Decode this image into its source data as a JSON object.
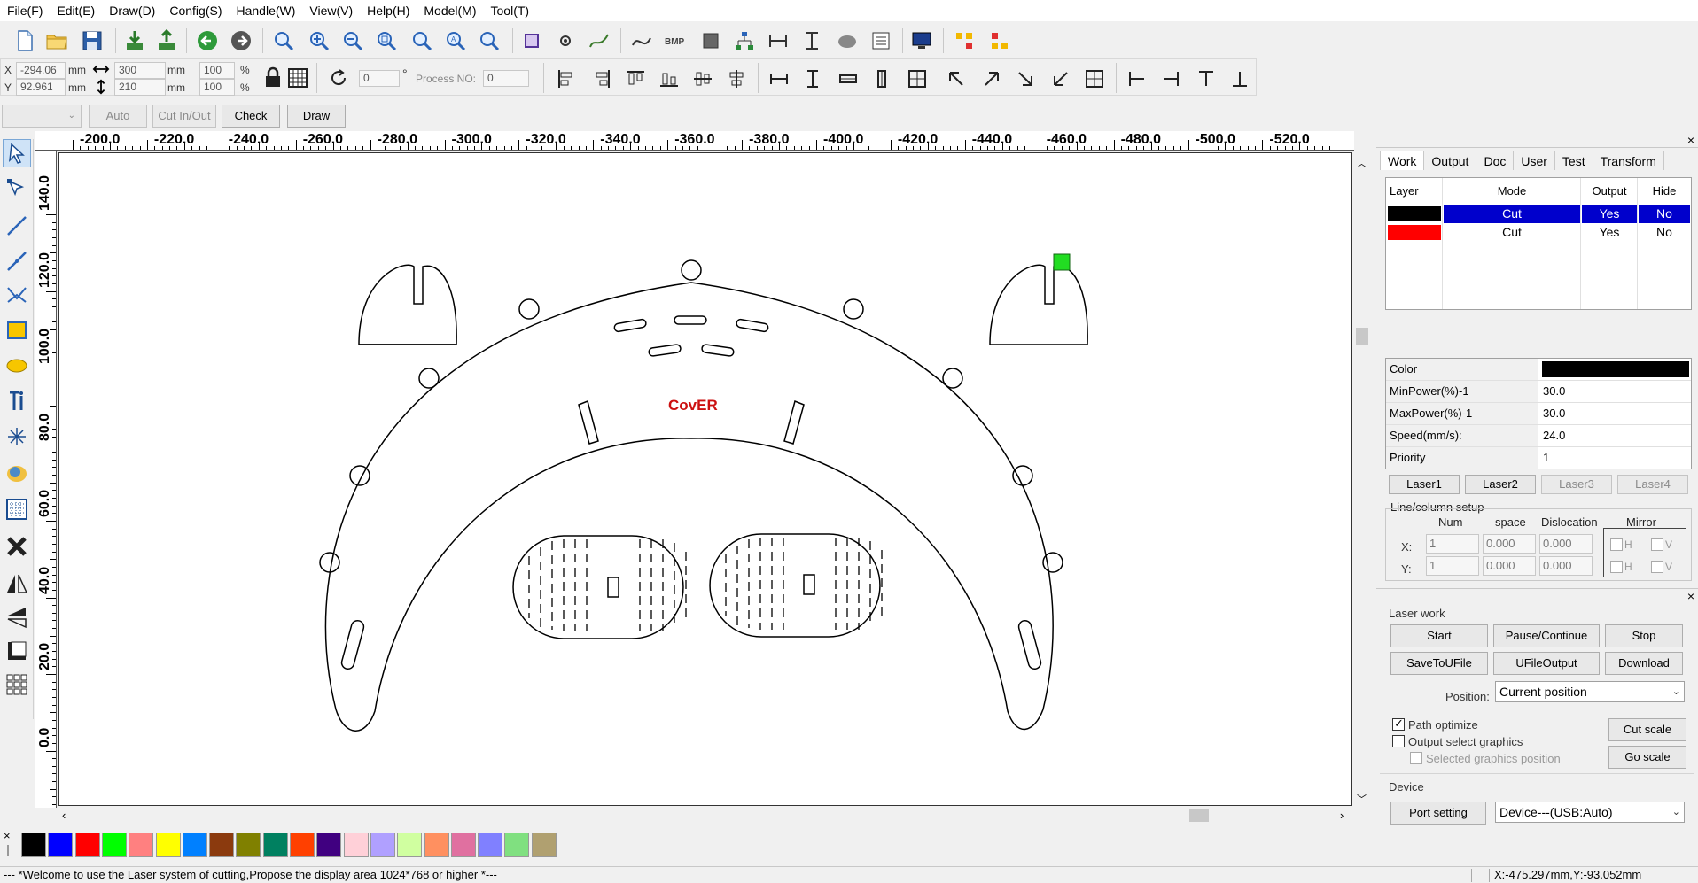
{
  "menu": [
    "File(F)",
    "Edit(E)",
    "Draw(D)",
    "Config(S)",
    "Handle(W)",
    "View(V)",
    "Help(H)",
    "Model(M)",
    "Tool(T)"
  ],
  "coords": {
    "x_label": "X",
    "y_label": "Y",
    "x_value": "-294.06",
    "y_value": "92.961",
    "unit": "mm",
    "width": "300",
    "height": "210",
    "scale_w": "100",
    "scale_h": "100",
    "percent": "%",
    "rotation": "0",
    "degree": "°",
    "process_label": "Process NO:",
    "process_value": "0"
  },
  "toolbar3": {
    "auto": "Auto",
    "cut_in_out": "Cut In/Out",
    "check": "Check",
    "draw": "Draw"
  },
  "ruler": {
    "h_labels": [
      "-200.0",
      "-220.0",
      "-240.0",
      "-260.0",
      "-280.0",
      "-300.0",
      "-320.0",
      "-340.0",
      "-360.0",
      "-380.0",
      "-400.0",
      "-420.0",
      "-440.0",
      "-460.0",
      "-480.0",
      "-500.0",
      "-520.0"
    ],
    "v_labels": [
      "140.0",
      "120.0",
      "100.0",
      "80.0",
      "60.0",
      "40.0",
      "20.0",
      "0.0"
    ]
  },
  "canvas": {
    "design_text": "CovER",
    "design_text_color": "#cc1111"
  },
  "palette": [
    "#000000",
    "#0000ff",
    "#ff0000",
    "#00ff00",
    "#ff8080",
    "#ffff00",
    "#0080ff",
    "#8b3a0e",
    "#808000",
    "#008060",
    "#ff4000",
    "#400080",
    "#ffd0d8",
    "#b0a0ff",
    "#d0ffa0",
    "#ff9060",
    "#e070a0",
    "#8080ff",
    "#80e080",
    "#b0a070"
  ],
  "right_panel": {
    "close": "×",
    "tabs": [
      "Work",
      "Output",
      "Doc",
      "User",
      "Test",
      "Transform"
    ],
    "active_tab": "Work",
    "layer_headers": [
      "Layer",
      "Mode",
      "Output",
      "Hide"
    ],
    "layers": [
      {
        "color": "#000000",
        "mode": "Cut",
        "output": "Yes",
        "hide": "No",
        "selected": true
      },
      {
        "color": "#ff0000",
        "mode": "Cut",
        "output": "Yes",
        "hide": "No",
        "selected": false
      }
    ],
    "props": [
      {
        "key": "Color",
        "value": ""
      },
      {
        "key": "MinPower(%)-1",
        "value": "30.0"
      },
      {
        "key": "MaxPower(%)-1",
        "value": "30.0"
      },
      {
        "key": "Speed(mm/s):",
        "value": "24.0"
      },
      {
        "key": "Priority",
        "value": "1"
      }
    ],
    "prop_color": "#000000",
    "lasers": [
      "Laser1",
      "Laser2",
      "Laser3",
      "Laser4"
    ],
    "line_col_title": "Line/column setup",
    "lc_headers": [
      "Num",
      "space",
      "Dislocation",
      "Mirror"
    ],
    "lc_x_label": "X:",
    "lc_y_label": "Y:",
    "lc_x": [
      "1",
      "0.000",
      "0.000"
    ],
    "lc_y": [
      "1",
      "0.000",
      "0.000"
    ],
    "mirror_h": "H",
    "mirror_v": "V"
  },
  "laser_work": {
    "title": "Laser work",
    "close": "×",
    "start": "Start",
    "pause": "Pause/Continue",
    "stop": "Stop",
    "save_ufile": "SaveToUFile",
    "ufile_output": "UFileOutput",
    "download": "Download",
    "position_label": "Position:",
    "position_value": "Current position",
    "path_optimize": "Path optimize",
    "path_optimize_checked": true,
    "output_select": "Output select graphics",
    "output_select_checked": false,
    "selected_pos": "Selected graphics position",
    "cut_scale": "Cut scale",
    "go_scale": "Go scale",
    "device_title": "Device",
    "port_setting": "Port setting",
    "device_value": "Device---(USB:Auto)"
  },
  "status": {
    "message": "--- *Welcome to use the Laser system of cutting,Propose the display area 1024*768 or higher *---",
    "cursor_pos": "X:-475.297mm,Y:-93.052mm"
  }
}
